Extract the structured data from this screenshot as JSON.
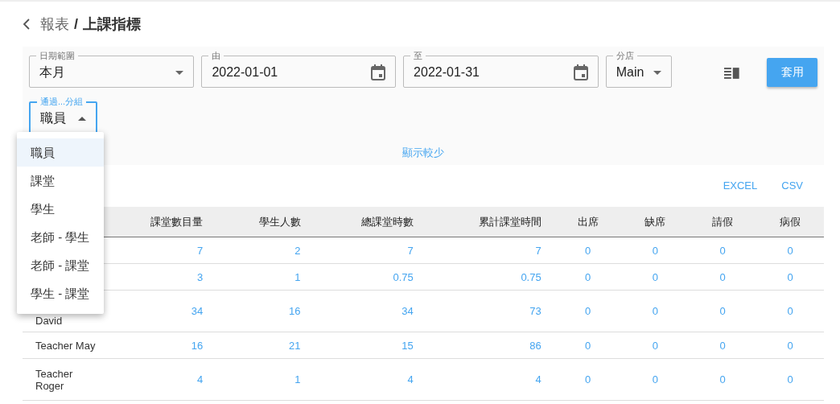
{
  "header": {
    "parent": "報表",
    "separator": "/",
    "title": "上課指標"
  },
  "filters": [
    {
      "kind": "select",
      "label": "日期範圍",
      "value": "本月"
    },
    {
      "kind": "date",
      "label": "由",
      "value": "2022-01-01"
    },
    {
      "kind": "date",
      "label": "至",
      "value": "2022-01-31"
    },
    {
      "kind": "select",
      "label": "分店",
      "value": "Main"
    }
  ],
  "apply_button": "套用",
  "group_by": {
    "label": "通過...分組",
    "value": "職員",
    "focused": true,
    "expanded": true
  },
  "group_menu": [
    {
      "label": "職員",
      "selected": true
    },
    {
      "label": "課堂",
      "selected": false
    },
    {
      "label": "學生",
      "selected": false
    },
    {
      "label": "老師 - 學生",
      "selected": false
    },
    {
      "label": "老師 - 課堂",
      "selected": false
    },
    {
      "label": "學生 - 課堂",
      "selected": false
    }
  ],
  "toggle_link": "顯示較少",
  "exports": [
    "EXCEL",
    "CSV"
  ],
  "table": {
    "columns": [
      "課堂數目量",
      "學生人數",
      "總課堂時數",
      "累計課堂時間",
      "出席",
      "缺席",
      "請假",
      "病假"
    ],
    "rows": [
      {
        "values": [
          "7",
          "2",
          "7",
          "7",
          "0",
          "0",
          "0",
          "0"
        ]
      },
      {
        "values": [
          "3",
          "1",
          "0.75",
          "0.75",
          "0",
          "0",
          "0",
          "0"
        ]
      },
      {
        "name": "David",
        "values": [
          "34",
          "16",
          "34",
          "73",
          "0",
          "0",
          "0",
          "0"
        ]
      },
      {
        "name": "Teacher May",
        "values": [
          "16",
          "21",
          "15",
          "86",
          "0",
          "0",
          "0",
          "0"
        ]
      },
      {
        "name": "Teacher Roger",
        "values": [
          "4",
          "1",
          "4",
          "4",
          "0",
          "0",
          "0",
          "0"
        ]
      }
    ]
  }
}
